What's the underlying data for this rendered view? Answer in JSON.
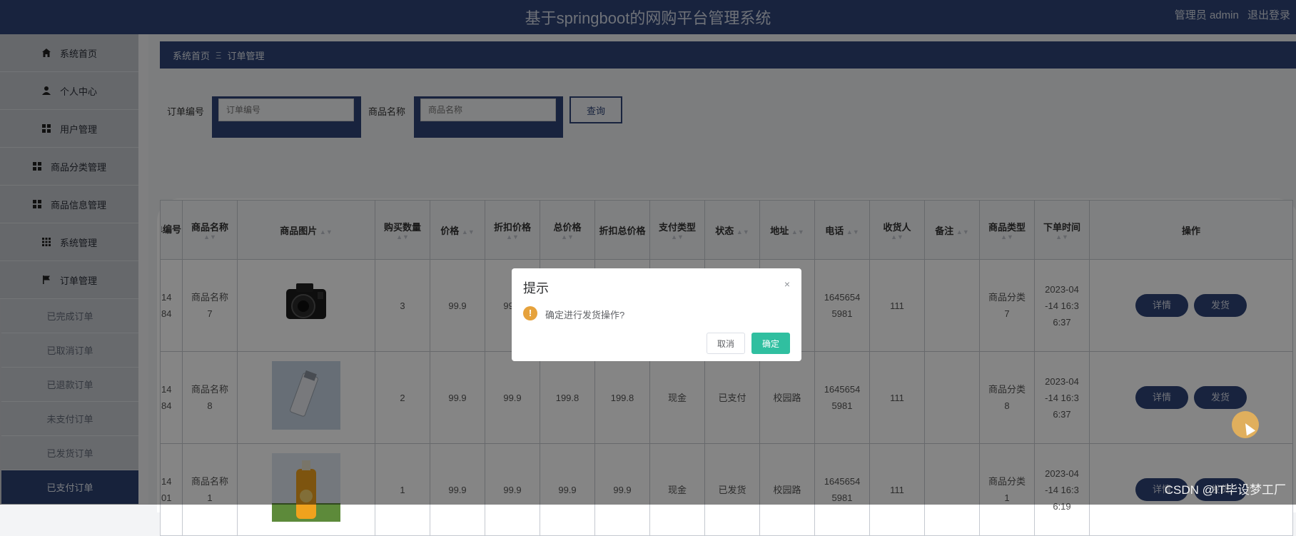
{
  "header": {
    "title": "基于springboot的网购平台管理系统",
    "user_label": "管理员 admin",
    "logout_label": "退出登录"
  },
  "sidebar": {
    "items": [
      {
        "label": "系统首页",
        "icon": "home-icon"
      },
      {
        "label": "个人中心",
        "icon": "user-icon"
      },
      {
        "label": "用户管理",
        "icon": "grid-icon"
      },
      {
        "label": "商品分类管理",
        "icon": "grid-icon"
      },
      {
        "label": "商品信息管理",
        "icon": "grid-icon"
      },
      {
        "label": "系统管理",
        "icon": "grid9-icon"
      },
      {
        "label": "订单管理",
        "icon": "flag-icon"
      }
    ],
    "subitems": [
      {
        "label": "已完成订单"
      },
      {
        "label": "已取消订单"
      },
      {
        "label": "已退款订单"
      },
      {
        "label": "未支付订单"
      },
      {
        "label": "已发货订单"
      },
      {
        "label": "已支付订单",
        "active": true
      }
    ]
  },
  "breadcrumb": {
    "home": "系统首页",
    "separator": "Ξ",
    "current": "订单管理"
  },
  "search": {
    "order_no_label": "订单编号",
    "order_no_placeholder": "订单编号",
    "product_name_label": "商品名称",
    "product_name_placeholder": "商品名称",
    "query_button": "查询"
  },
  "table": {
    "columns": [
      "订单编号",
      "商品名称",
      "商品图片",
      "购买数量",
      "价格",
      "折扣价格",
      "总价格",
      "折扣总价格",
      "支付类型",
      "状态",
      "地址",
      "电话",
      "收货人",
      "备注",
      "商品类型",
      "下单时间",
      "操作"
    ],
    "rows": [
      {
        "order_no": "14\n84",
        "name": "商品名称\n7",
        "image": "camera",
        "qty": "3",
        "price": "99.9",
        "disc_price": "99.9",
        "total": "",
        "disc_total": "",
        "pay": "",
        "status": "",
        "addr": "",
        "phone": "1645654\n5981",
        "receiver": "111",
        "note": "",
        "category": "商品分类\n7",
        "time": "2023-04\n-14 16:3\n6:37",
        "detail_btn": "详情",
        "ship_btn": "发货"
      },
      {
        "order_no": "14\n84",
        "name": "商品名称\n8",
        "image": "bottle",
        "qty": "2",
        "price": "99.9",
        "disc_price": "99.9",
        "total": "199.8",
        "disc_total": "199.8",
        "pay": "现金",
        "status": "已支付",
        "addr": "校园路",
        "phone": "1645654\n5981",
        "receiver": "111",
        "note": "",
        "category": "商品分类\n8",
        "time": "2023-04\n-14 16:3\n6:37",
        "detail_btn": "详情",
        "ship_btn": "发货"
      },
      {
        "order_no": "14\n01",
        "name": "商品名称\n1",
        "image": "juice",
        "qty": "1",
        "price": "99.9",
        "disc_price": "99.9",
        "total": "99.9",
        "disc_total": "99.9",
        "pay": "现金",
        "status": "已发货",
        "addr": "校园路",
        "phone": "1645654\n5981",
        "receiver": "111",
        "note": "",
        "category": "商品分类\n1",
        "time": "2023-04\n-14 16:3\n6:19",
        "detail_btn": "详情",
        "ship_btn": "发货"
      }
    ]
  },
  "dialog": {
    "title": "提示",
    "close": "×",
    "warn_icon": "!",
    "message": "确定进行发货操作?",
    "cancel": "取消",
    "ok": "确定"
  },
  "watermark": "CSDN @IT毕设梦工厂",
  "colors": {
    "primary": "#2e4477",
    "ok": "#30bfa0",
    "warn": "#e6a23c"
  }
}
